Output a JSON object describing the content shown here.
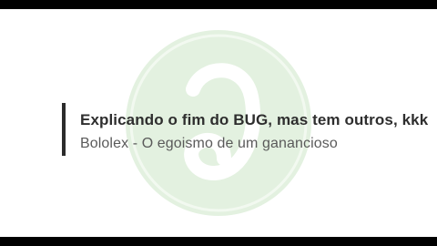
{
  "video": {
    "headline": "Explicando o fim do BUG, mas tem outros, kkk",
    "subtitle": "Bololex - O egoismo de um ganancioso"
  },
  "watermark": {
    "icon": "app-logo-watermark",
    "circle_color": "#e3f1e0",
    "ring_color": "#f2f9f0",
    "glyph_color": "#ffffff"
  },
  "colors": {
    "letterbox": "#000000",
    "background": "#ffffff",
    "accent_bar": "#2b2b2b",
    "headline": "#2e2e2e",
    "subtitle": "#5a5a5a"
  }
}
